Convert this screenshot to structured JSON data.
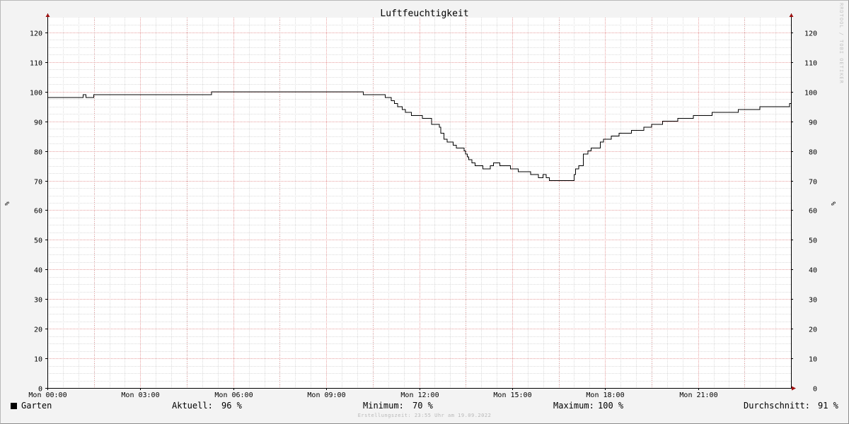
{
  "chart_data": {
    "type": "line",
    "title": "Luftfeuchtigkeit",
    "ylabel_left": "%",
    "ylabel_right": "%",
    "ylim": [
      0,
      125
    ],
    "yticks": [
      0,
      10,
      20,
      30,
      40,
      50,
      60,
      70,
      80,
      90,
      100,
      110,
      120
    ],
    "xlim": [
      0,
      24
    ],
    "xticks": [
      {
        "hour": 0,
        "label": "Mon 00:00"
      },
      {
        "hour": 3,
        "label": "Mon 03:00"
      },
      {
        "hour": 6,
        "label": "Mon 06:00"
      },
      {
        "hour": 9,
        "label": "Mon 09:00"
      },
      {
        "hour": 12,
        "label": "Mon 12:00"
      },
      {
        "hour": 15,
        "label": "Mon 15:00"
      },
      {
        "hour": 18,
        "label": "Mon 18:00"
      },
      {
        "hour": 21,
        "label": "Mon 21:00"
      }
    ],
    "grid": true,
    "series": [
      {
        "name": "Garten",
        "color": "#000000",
        "step": true,
        "points": [
          [
            0.0,
            98
          ],
          [
            1.15,
            99
          ],
          [
            1.25,
            98
          ],
          [
            1.5,
            99
          ],
          [
            5.3,
            100
          ],
          [
            10.2,
            99
          ],
          [
            10.9,
            98
          ],
          [
            11.1,
            97
          ],
          [
            11.2,
            96
          ],
          [
            11.3,
            95
          ],
          [
            11.45,
            94
          ],
          [
            11.55,
            93
          ],
          [
            11.75,
            92
          ],
          [
            12.1,
            91
          ],
          [
            12.4,
            89
          ],
          [
            12.65,
            88
          ],
          [
            12.7,
            86
          ],
          [
            12.8,
            84
          ],
          [
            12.9,
            83
          ],
          [
            13.1,
            82
          ],
          [
            13.2,
            81
          ],
          [
            13.45,
            80
          ],
          [
            13.5,
            79
          ],
          [
            13.55,
            78
          ],
          [
            13.6,
            77
          ],
          [
            13.7,
            76
          ],
          [
            13.8,
            75
          ],
          [
            14.05,
            74
          ],
          [
            14.3,
            75
          ],
          [
            14.4,
            76
          ],
          [
            14.6,
            75
          ],
          [
            14.95,
            74
          ],
          [
            15.2,
            73
          ],
          [
            15.6,
            72
          ],
          [
            15.85,
            71
          ],
          [
            16.0,
            72
          ],
          [
            16.1,
            71
          ],
          [
            16.2,
            70
          ],
          [
            17.0,
            72
          ],
          [
            17.05,
            74
          ],
          [
            17.15,
            75
          ],
          [
            17.3,
            79
          ],
          [
            17.45,
            80
          ],
          [
            17.55,
            81
          ],
          [
            17.85,
            83
          ],
          [
            17.95,
            84
          ],
          [
            18.2,
            85
          ],
          [
            18.45,
            86
          ],
          [
            18.85,
            87
          ],
          [
            19.25,
            88
          ],
          [
            19.5,
            89
          ],
          [
            19.85,
            90
          ],
          [
            20.35,
            91
          ],
          [
            20.85,
            92
          ],
          [
            21.45,
            93
          ],
          [
            22.3,
            94
          ],
          [
            23.0,
            95
          ],
          [
            23.95,
            96
          ],
          [
            24.0,
            96
          ]
        ]
      }
    ],
    "legend": {
      "name": "Garten",
      "stats": [
        {
          "label": "Aktuell:",
          "value": "96 %"
        },
        {
          "label": "Minimum:",
          "value": "70 %"
        },
        {
          "label": "Maximum:",
          "value": "100 %"
        },
        {
          "label": "Durchschnitt:",
          "value": "91 %"
        }
      ]
    }
  },
  "footer": {
    "credit": "Erstellungszeit: 23:55 Uhr am 19.09.2022",
    "watermark": "RRDTOOL / TOBI OETIKER"
  },
  "colors": {
    "canvas": "#ffffff",
    "background": "#f3f3f3",
    "minor_grid": "#dcdcdc",
    "major_grid": "#e8a0a0",
    "axis": "#000000",
    "arrow": "#a01010",
    "line": "#000000"
  }
}
